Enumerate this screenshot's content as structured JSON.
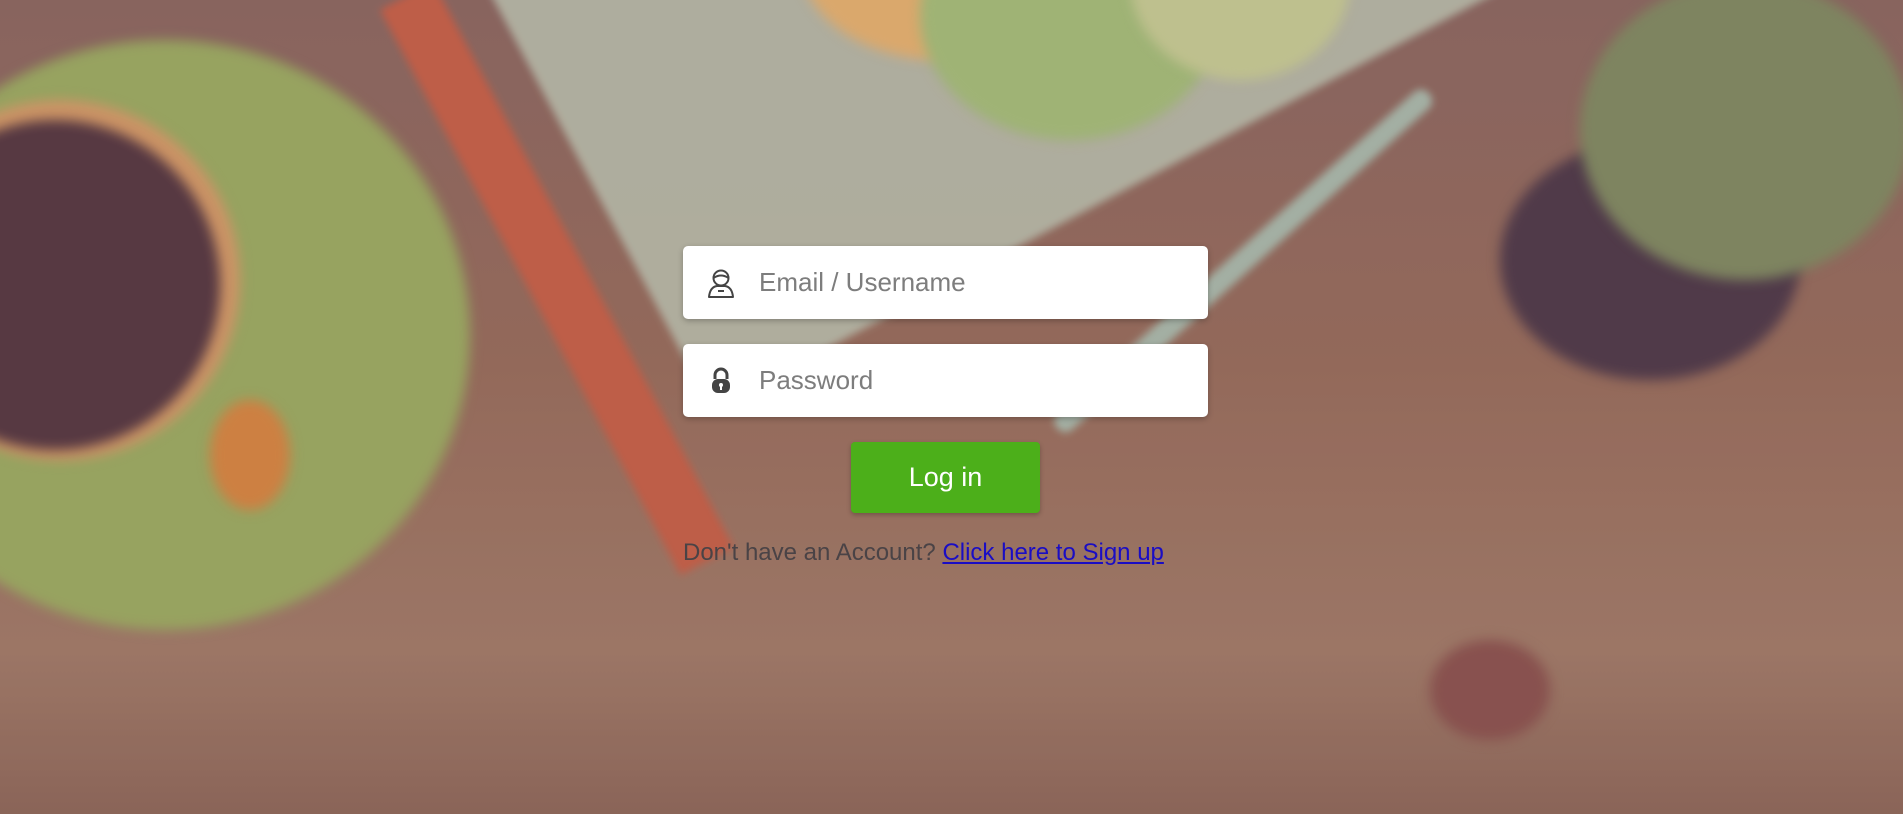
{
  "login_form": {
    "username_placeholder": "Email / Username",
    "username_value": "",
    "password_placeholder": "Password",
    "password_value": "",
    "submit_label": "Log in",
    "signup_prompt": "Don't have an Account?",
    "signup_link": "Click here to Sign up"
  },
  "icons": {
    "username": "user-icon",
    "password": "lock-icon"
  },
  "colors": {
    "button_bg": "#4caf1a",
    "link": "#1a0dc4",
    "prompt_text": "#4a4346"
  }
}
